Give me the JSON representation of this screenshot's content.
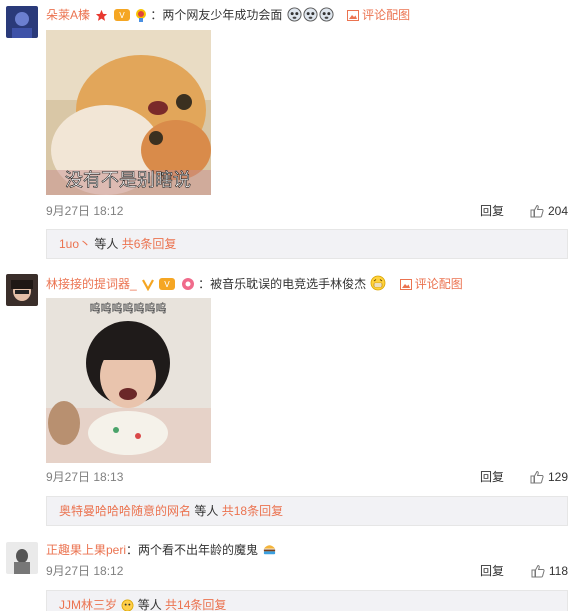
{
  "comments": [
    {
      "username": "朵莱A榛",
      "colon": "：",
      "text": "两个网友少年成功会面",
      "picture_link": "评论配图",
      "image_caption": "没有不是别瞎说",
      "time": "9月27日 18:12",
      "reply_label": "回复",
      "likes": "204",
      "replies": {
        "names": "1uo丶",
        "suffix": "等人",
        "count": "共6条回复"
      }
    },
    {
      "username": "林接接的提词器_",
      "colon": "：",
      "text": "被音乐耽误的电竞选手林俊杰",
      "picture_link": "评论配图",
      "image_caption": "呜呜呜呜呜呜呜",
      "time": "9月27日 18:13",
      "reply_label": "回复",
      "likes": "129",
      "replies": {
        "names": "奥特曼哈哈哈随意的网名",
        "suffix": "等人",
        "count": "共18条回复"
      }
    },
    {
      "username": "正趣果上果peri",
      "colon": "：",
      "text": "两个看不出年龄的魔鬼",
      "time": "9月27日 18:12",
      "reply_label": "回复",
      "likes": "118",
      "replies": {
        "names": "JJM林三岁",
        "suffix": "等人",
        "count": "共14条回复"
      }
    }
  ],
  "colors": {
    "accent": "#eb7350",
    "text": "#333333",
    "muted": "#808080",
    "reply_bg": "#f2f2f5"
  },
  "icons": [
    "avatar",
    "star-badge",
    "vip-badge",
    "medal-badge",
    "crying-emoji",
    "grin-emoji",
    "picture-icon",
    "thumbs-up-icon"
  ]
}
